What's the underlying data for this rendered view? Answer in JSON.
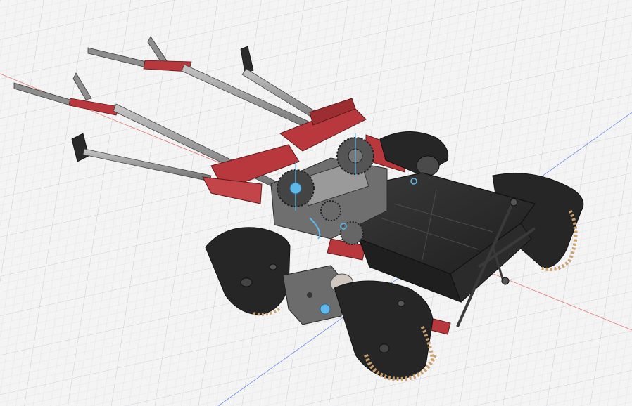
{
  "app": {
    "view": "3d-model-viewport",
    "grid": true,
    "axes": {
      "x_color": "#e0524d",
      "y_color": "#4d6ee0"
    }
  },
  "colors": {
    "background": "#f4f4f5",
    "grid_minor": "#e4e4e6",
    "grid_major": "#d3d3d6",
    "frame_red": "#b8383d",
    "frame_dark_red": "#7d2327",
    "tube_gray": "#8a8a8a",
    "tube_light": "#b9b9b9",
    "body_dark": "#2a2a2a",
    "body_mid": "#3c3c3c",
    "gear_gray": "#6c6c6c",
    "highlight_blue": "#5fb8e8",
    "track_tan": "#c9a070"
  },
  "model": {
    "parts": [
      "handle-left-outer",
      "handle-left-inner",
      "handle-right-inner",
      "handle-right-outer",
      "red-frame",
      "gearbox",
      "chassis-plate",
      "tread-front-left",
      "tread-rear-left",
      "tread-front-right",
      "tread-rear-right",
      "steering-linkage"
    ]
  }
}
